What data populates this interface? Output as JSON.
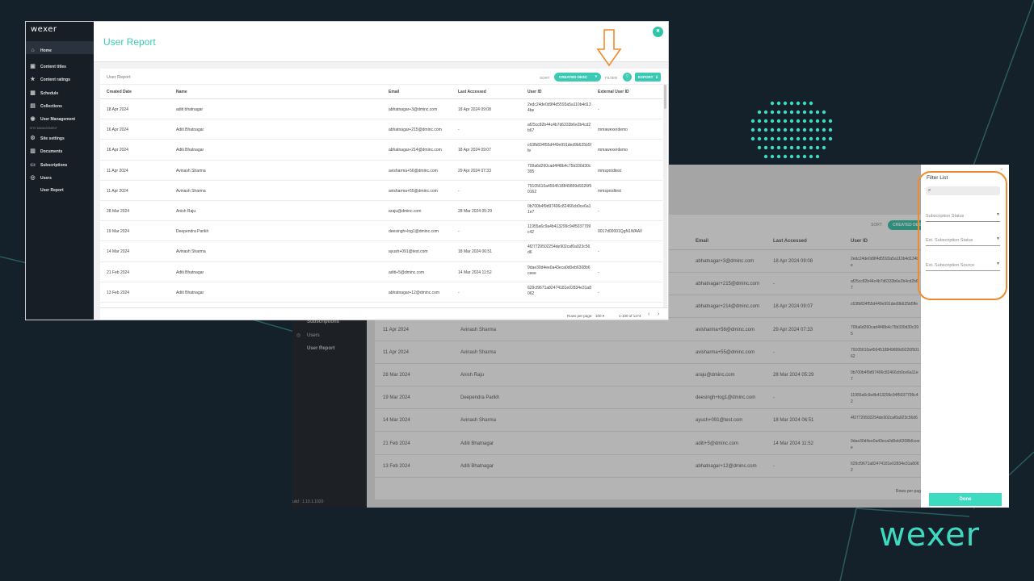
{
  "brand": {
    "logo": "wexer"
  },
  "front": {
    "sidebar": {
      "logo": "wexer",
      "items": [
        {
          "label": "Home",
          "icon": "home-icon"
        },
        {
          "label": "Content titles",
          "icon": "film-icon"
        },
        {
          "label": "Content ratings",
          "icon": "star-icon"
        },
        {
          "label": "Schedule",
          "icon": "calendar-icon"
        },
        {
          "label": "Collections",
          "icon": "grid-icon"
        },
        {
          "label": "User Management",
          "icon": "user-icon"
        },
        {
          "label": "Site settings",
          "icon": "gear-icon"
        },
        {
          "label": "Documents",
          "icon": "document-icon"
        },
        {
          "label": "Subscriptions",
          "icon": "card-icon"
        },
        {
          "label": "Users",
          "icon": "users-icon"
        },
        {
          "label": "User Report",
          "icon": ""
        }
      ],
      "section_label": "SITE MANAGEMENT"
    },
    "page_title": "User Report",
    "card": {
      "title": "User Report",
      "sort_label": "SORT",
      "sort_value": "CREATED DESC",
      "filter_label": "FILTER",
      "export_label": "EXPORT"
    },
    "columns": [
      "Created Date",
      "Name",
      "Email",
      "Last Accessed",
      "User ID",
      "External User ID"
    ],
    "rows": [
      [
        "18 Apr 2024",
        "aditi bhatnagar",
        "abhatnagar+3@dminc.com",
        "18 Apr 2024 09:08",
        "2edc24de0d9f4d5593a5a110b4d134be",
        "-"
      ],
      [
        "16 Apr 2024",
        "Aditi Bhatnagar",
        "abhatnagar+215@dminc.com",
        "-",
        "af25cc82b44c4b7d6333b6e2b4cd2b67",
        "mmawexerdemo"
      ],
      [
        "16 Apr 2024",
        "Aditi Bhatnagar",
        "abhatnagar+214@dminc.com",
        "18 Apr 2024 09:07",
        "c63fb834f55d449e991ded9b625b5ffe",
        "mmawexerdemo"
      ],
      [
        "11 Apr 2024",
        "Avinash Sharma",
        "avisharma+56@dminc.com",
        "29 Apr 2024 07:33",
        "709a6d260cad4f48b4c75b330d30c395",
        "mmsprodtest"
      ],
      [
        "11 Apr 2024",
        "Avinash Sharma",
        "avisharma+55@dminc.com",
        "-",
        "79105610a4564518849899d9226f50162",
        "mmsprodtest"
      ],
      [
        "28 Mar 2024",
        "Anish Raju",
        "araju@dminc.com",
        "28 Mar 2024 05:29",
        "0b700b4f9d97406c82466cb0ce6a11e7",
        "-"
      ],
      [
        "19 Mar 2024",
        "Deependra Parikh",
        "deesingh+log1@dminc.com",
        "-",
        "11955a6c9a4b413299c94f5037799c42",
        "0017d00001QgN1WAAV"
      ],
      [
        "14 Mar 2024",
        "Avinash Sharma",
        "ayush+091@test.com",
        "18 Mar 2024 06:51",
        "4f27729502254de902caf0a923c56d6",
        "-"
      ],
      [
        "21 Feb 2024",
        "Aditi Bhatnagar",
        "aditi+5@dminc.com",
        "14 Mar 2024 11:52",
        "9dae30d4ee0a43eca0d0eb6308b6ceee",
        "-"
      ],
      [
        "13 Feb 2024",
        "Aditi Bhatnagar",
        "abhatnagar+12@dminc.com",
        "-",
        "629cf9671a82474181e02834e31a8062",
        "-"
      ]
    ],
    "footer": {
      "rows_per_page_label": "Rows per page:",
      "rows_per_page_value": "100 ▾",
      "range": "1-100 of 1174",
      "prev": "‹",
      "next": "›"
    }
  },
  "back": {
    "sidebar": {
      "items": [
        {
          "label": "Subscriptions"
        },
        {
          "label": "Users"
        },
        {
          "label": "User Report"
        }
      ],
      "build": "uild : 1.10.1.1020"
    },
    "sort_label": "SORT",
    "sort_value": "CREATED DESC",
    "columns": [
      "Email",
      "Last Accessed",
      "User ID"
    ],
    "rows": [
      [
        "",
        "",
        "abhatnagar+3@dminc.com",
        "18 Apr 2024 09:08",
        "2edc24de0d9f4d5593a5a110b4d134be"
      ],
      [
        "",
        "",
        "abhatnagar+215@dminc.com",
        "-",
        "af25cc82b44c4b7d6333b6e2b4cd2b67"
      ],
      [
        "",
        "",
        "abhatnagar+214@dminc.com",
        "18 Apr 2024 09:07",
        "c63fb834f55d449e991ded9b625b5ffe"
      ],
      [
        "11 Apr 2024",
        "Avinash Sharma",
        "avisharma+56@dminc.com",
        "29 Apr 2024 07:33",
        "709a6d260cad4f48b4c75b330d30c395"
      ],
      [
        "11 Apr 2024",
        "Avinash Sharma",
        "avisharma+55@dminc.com",
        "-",
        "79105610a4564518849899d9226f50162"
      ],
      [
        "28 Mar 2024",
        "Anish Raju",
        "araju@dminc.com",
        "28 Mar 2024 05:29",
        "0b700b4f9d97406c82466cb0ce6a11e7"
      ],
      [
        "19 Mar 2024",
        "Deependra Parikh",
        "deesingh+log1@dminc.com",
        "-",
        "11955a6c9a4b413299c94f5037799c42"
      ],
      [
        "14 Mar 2024",
        "Avinash Sharma",
        "ayush+091@test.com",
        "18 Mar 2024 06:51",
        "4f27729502254de902caf0a923c56d6"
      ],
      [
        "21 Feb 2024",
        "Aditi Bhatnagar",
        "aditi+5@dminc.com",
        "14 Mar 2024 11:52",
        "9dae30d4ee0a43eca0d0eb6308b6ceee"
      ],
      [
        "13 Feb 2024",
        "Aditi Bhatnagar",
        "abhatnagar+12@dminc.com",
        "-",
        "629cf9671a82474181e02834e31a8062"
      ]
    ],
    "rows_per_page_label": "Rows per pag",
    "filter": {
      "title": "Filter List",
      "close": "×",
      "search_placeholder": "",
      "selects": [
        "Subscription Status",
        "Ext. Subscription Status",
        "Ext. Subscription Source"
      ],
      "done_label": "Done"
    }
  },
  "colors": {
    "accent": "#3ccab4",
    "highlight": "#f08a2c",
    "background": "#14202a"
  }
}
